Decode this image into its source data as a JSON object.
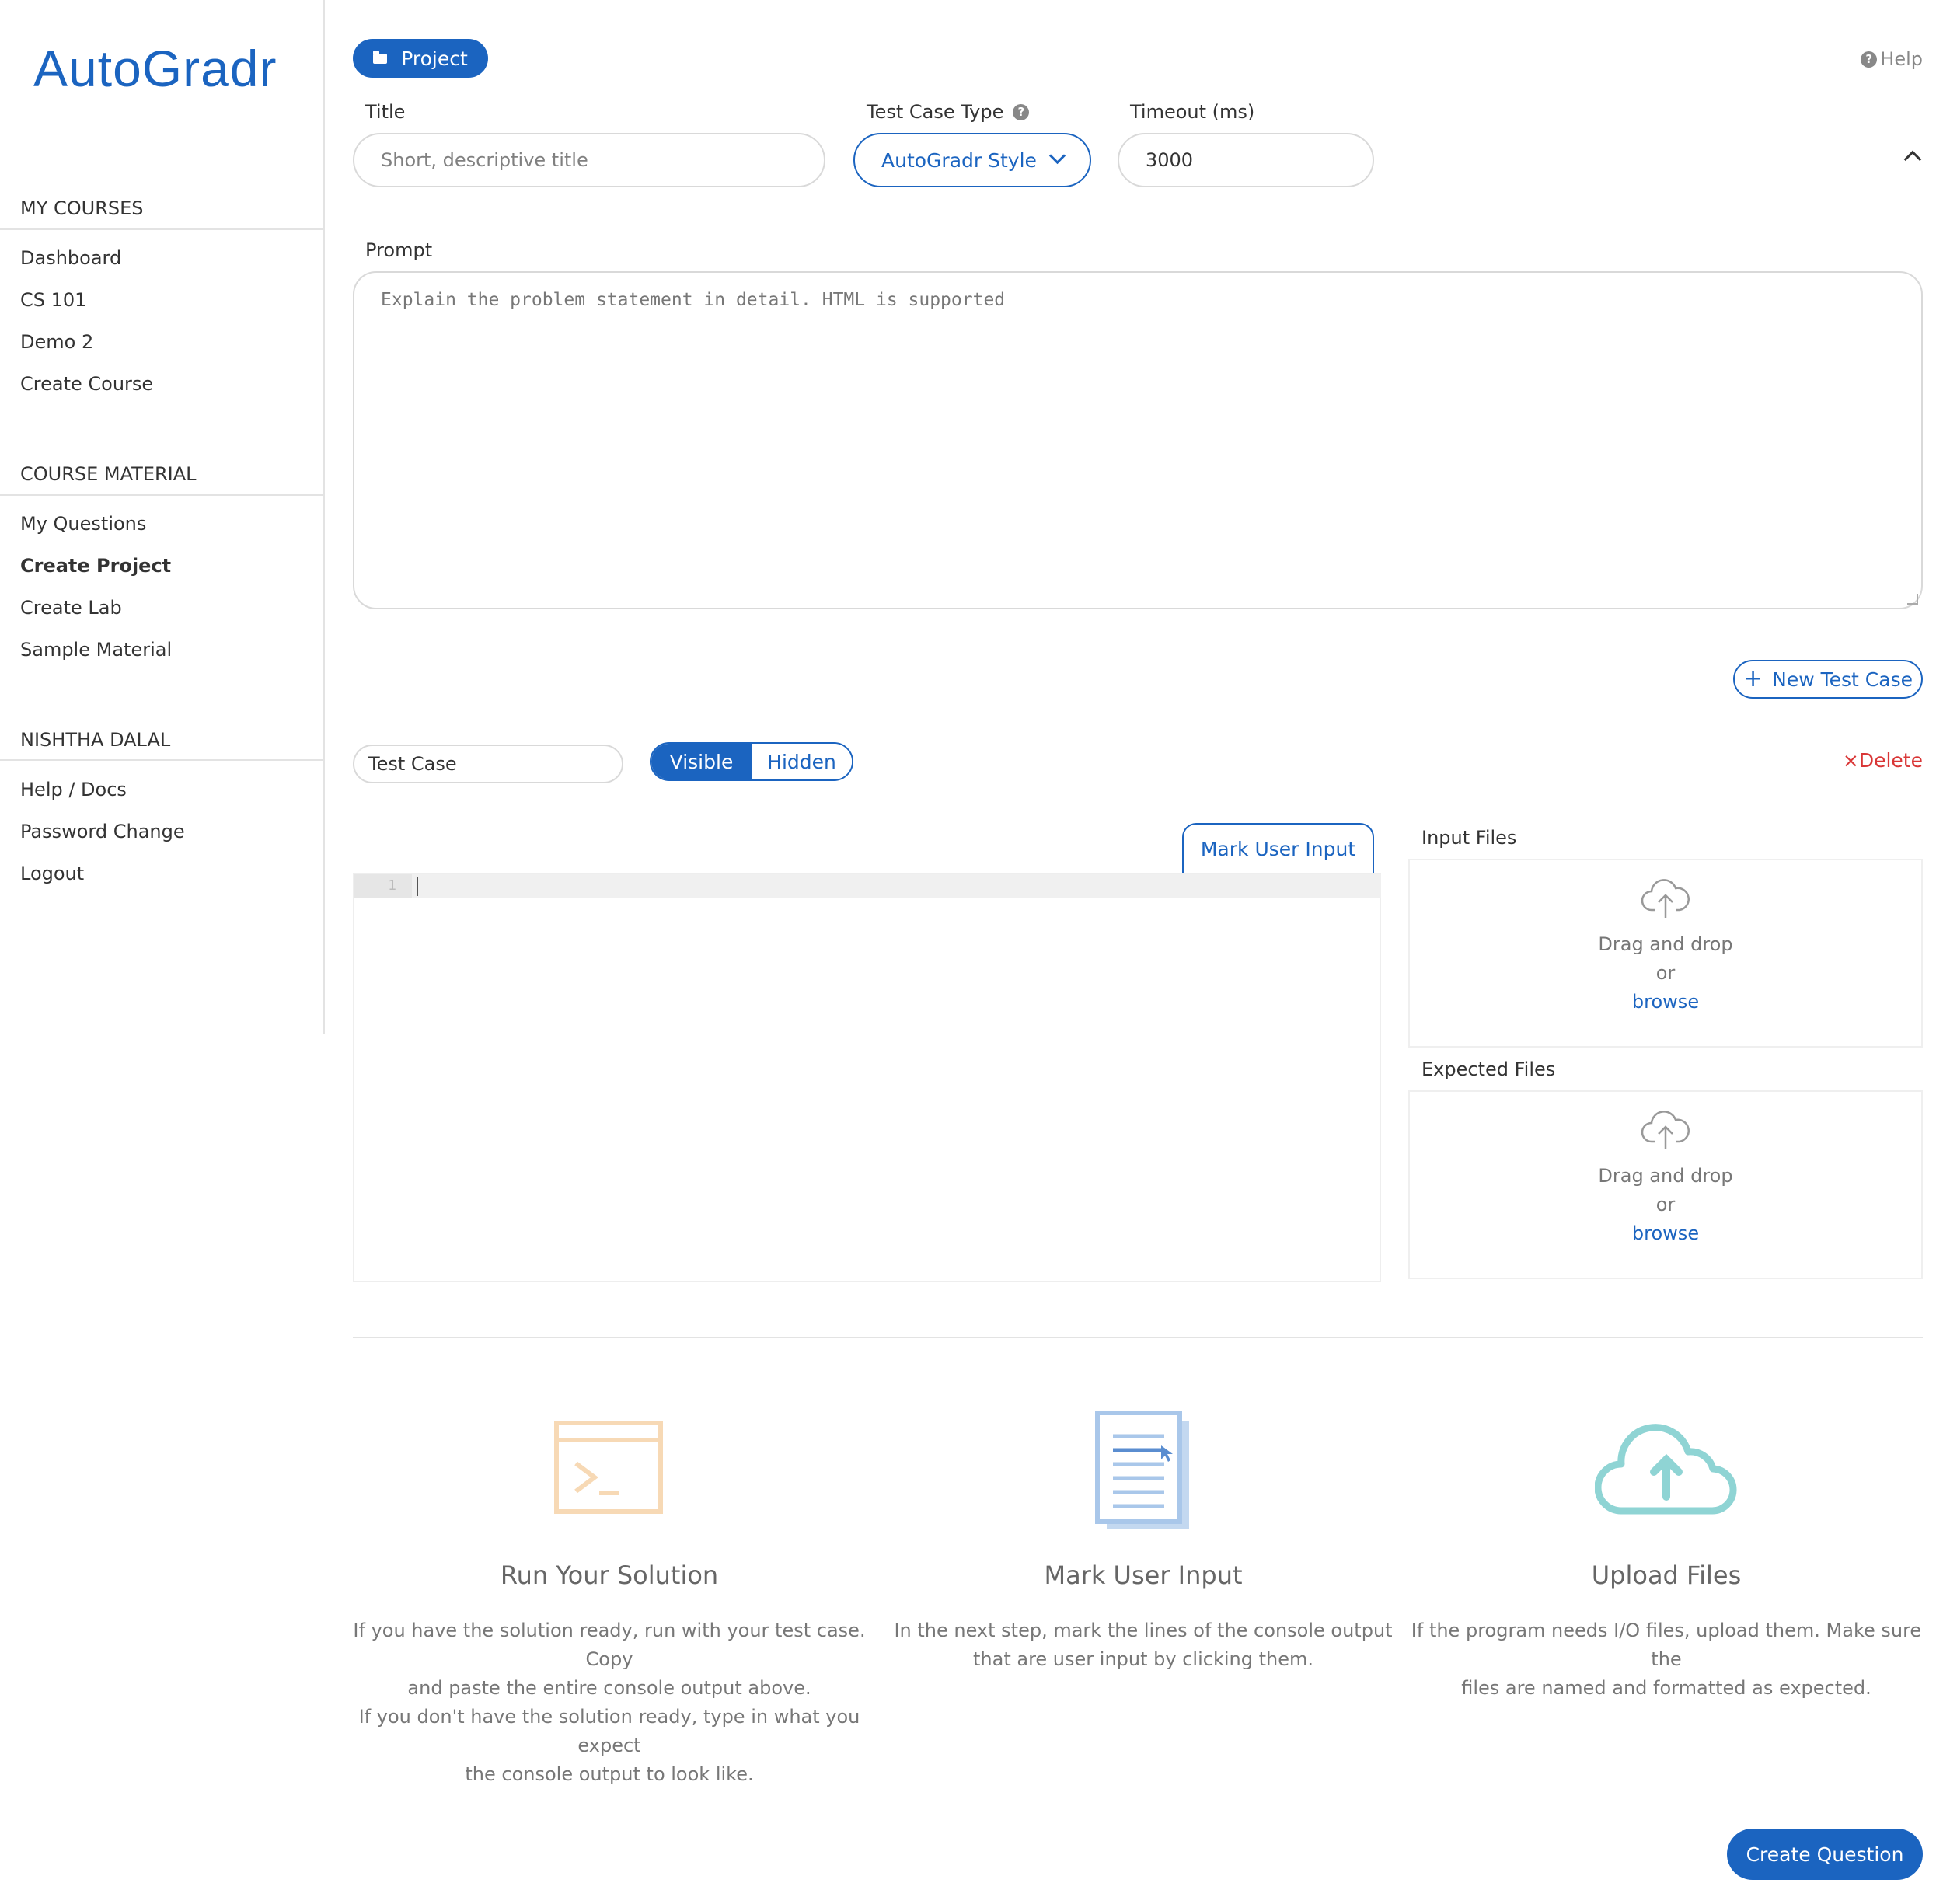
{
  "brand": "AutoGradr",
  "sidebar": {
    "sections": [
      {
        "heading": "MY COURSES",
        "items": [
          "Dashboard",
          "CS 101",
          "Demo 2",
          "Create Course"
        ]
      },
      {
        "heading": "COURSE MATERIAL",
        "items": [
          "My Questions",
          "Create Project",
          "Create Lab",
          "Sample Material"
        ]
      },
      {
        "heading": "NISHTHA DALAL",
        "items": [
          "Help / Docs",
          "Password Change",
          "Logout"
        ]
      }
    ],
    "active_item": "Create Project"
  },
  "header": {
    "project_pill": "Project",
    "help": "Help",
    "help_icon": "question-circle-icon"
  },
  "form": {
    "title_label": "Title",
    "title_placeholder": "Short, descriptive title",
    "type_label": "Test Case Type",
    "type_value": "AutoGradr Style",
    "timeout_label": "Timeout (ms)",
    "timeout_value": "3000",
    "prompt_label": "Prompt",
    "prompt_placeholder": "Explain the problem statement in detail. HTML is supported"
  },
  "test_case": {
    "new_button": "New Test Case",
    "name_value": "Test Case",
    "visibility_options": [
      "Visible",
      "Hidden"
    ],
    "selected_visibility": "Visible",
    "delete": "Delete",
    "mark_user_input": "Mark User Input",
    "line_number": "1",
    "input_files_label": "Input Files",
    "expected_files_label": "Expected Files",
    "drop_text": "Drag and drop",
    "drop_or": "or",
    "drop_browse": "browse"
  },
  "features": [
    {
      "icon": "terminal-icon",
      "title": "Run Your Solution",
      "lines": [
        "If you have the solution ready, run with your test case. Copy",
        "and paste the entire console output above.",
        "If you don't have the solution ready, type in what you expect",
        "the console output to look like."
      ]
    },
    {
      "icon": "document-icon",
      "title": "Mark User Input",
      "lines": [
        "In the next step, mark the lines of the console output",
        "that are user input by clicking them."
      ]
    },
    {
      "icon": "cloud-upload-icon",
      "title": "Upload Files",
      "lines": [
        "If the program needs I/O files, upload them. Make sure the",
        "files are named and formatted as expected."
      ]
    }
  ],
  "create_button": "Create Question",
  "colors": {
    "primary": "#1b64c0",
    "danger": "#d93636",
    "terminal": "#f7d9b5",
    "document": "#a9c7ea",
    "cloud": "#8fd4d4"
  }
}
